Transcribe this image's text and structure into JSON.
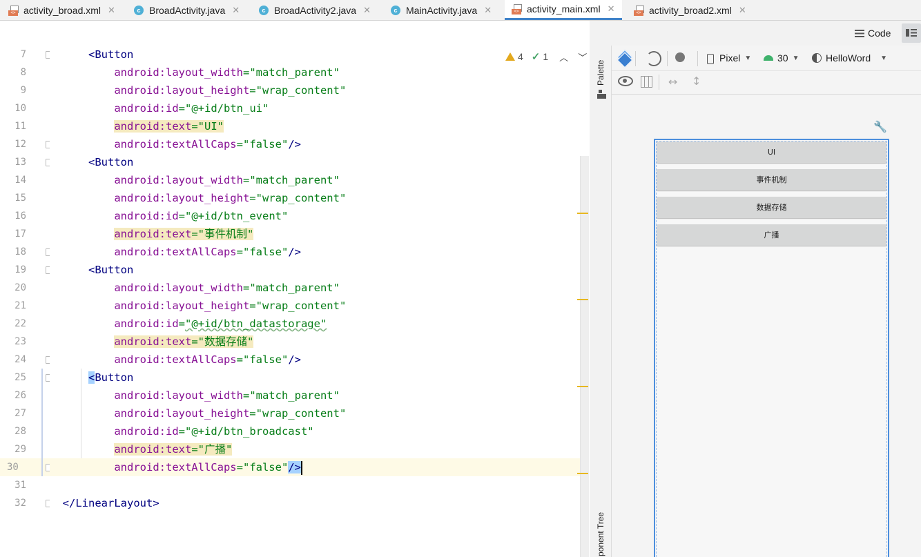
{
  "tabs": [
    {
      "label": "activity_broad.xml",
      "type": "xml",
      "active": false
    },
    {
      "label": "BroadActivity.java",
      "type": "class",
      "active": false
    },
    {
      "label": "BroadActivity2.java",
      "type": "class",
      "active": false
    },
    {
      "label": "MainActivity.java",
      "type": "class",
      "active": false
    },
    {
      "label": "activity_main.xml",
      "type": "xml",
      "active": true
    },
    {
      "label": "activity_broad2.xml",
      "type": "xml",
      "active": false
    }
  ],
  "mode_bar": {
    "code_label": "Code"
  },
  "inspection": {
    "warnings": "4",
    "ok": "1"
  },
  "editor": {
    "line_numbers": [
      "7",
      "8",
      "9",
      "10",
      "11",
      "12",
      "13",
      "14",
      "15",
      "16",
      "17",
      "18",
      "19",
      "20",
      "21",
      "22",
      "23",
      "24",
      "25",
      "26",
      "27",
      "28",
      "29",
      "30",
      "31",
      "32"
    ],
    "lines": {
      "l7": {
        "tag": "<Button"
      },
      "l8": {
        "attr": "android:layout_width",
        "eq": "=",
        "val": "\"match_parent\""
      },
      "l9": {
        "attr": "android:layout_height",
        "eq": "=",
        "val": "\"wrap_content\""
      },
      "l10": {
        "attr": "android:id",
        "eq": "=",
        "val": "\"@+id/btn_ui\""
      },
      "l11": {
        "attr": "android:text",
        "eq": "=",
        "val": "\"UI\""
      },
      "l12": {
        "attr": "android:textAllCaps",
        "eq": "=",
        "val": "\"false\"",
        "end": "/>"
      },
      "l13": {
        "tag": "<Button"
      },
      "l14": {
        "attr": "android:layout_width",
        "eq": "=",
        "val": "\"match_parent\""
      },
      "l15": {
        "attr": "android:layout_height",
        "eq": "=",
        "val": "\"wrap_content\""
      },
      "l16": {
        "attr": "android:id",
        "eq": "=",
        "val": "\"@+id/btn_event\""
      },
      "l17": {
        "attr": "android:text",
        "eq": "=",
        "val": "\"事件机制\""
      },
      "l18": {
        "attr": "android:textAllCaps",
        "eq": "=",
        "val": "\"false\"",
        "end": "/>"
      },
      "l19": {
        "tag": "<Button"
      },
      "l20": {
        "attr": "android:layout_width",
        "eq": "=",
        "val": "\"match_parent\""
      },
      "l21": {
        "attr": "android:layout_height",
        "eq": "=",
        "val": "\"wrap_content\""
      },
      "l22": {
        "attr": "android:id",
        "eq": "=",
        "val": "\"@+id/btn_datastorage\""
      },
      "l23": {
        "attr": "android:text",
        "eq": "=",
        "val": "\"数据存储\""
      },
      "l24": {
        "attr": "android:textAllCaps",
        "eq": "=",
        "val": "\"false\"",
        "end": "/>"
      },
      "l25": {
        "lt": "<",
        "tag": "Button"
      },
      "l26": {
        "attr": "android:layout_width",
        "eq": "=",
        "val": "\"match_parent\""
      },
      "l27": {
        "attr": "android:layout_height",
        "eq": "=",
        "val": "\"wrap_content\""
      },
      "l28": {
        "attr": "android:id",
        "eq": "=",
        "val": "\"@+id/btn_broadcast\""
      },
      "l29": {
        "attr": "android:text",
        "eq": "=",
        "val": "\"广播\""
      },
      "l30": {
        "attr": "android:textAllCaps",
        "eq": "=",
        "val": "\"false\"",
        "end": "/>"
      },
      "l32": {
        "tag": "</LinearLayout>"
      }
    }
  },
  "side_panel": {
    "palette": "Palette",
    "component_tree": "ponent Tree"
  },
  "design": {
    "device": "Pixel",
    "api": "30",
    "theme": "HelloWord",
    "preview_buttons": [
      "UI",
      "事件机制",
      "数据存储",
      "广播"
    ]
  },
  "colors": {
    "accent": "#4083c9",
    "warning_stripe": "#e7b821",
    "selection": "#4d8fdd"
  }
}
